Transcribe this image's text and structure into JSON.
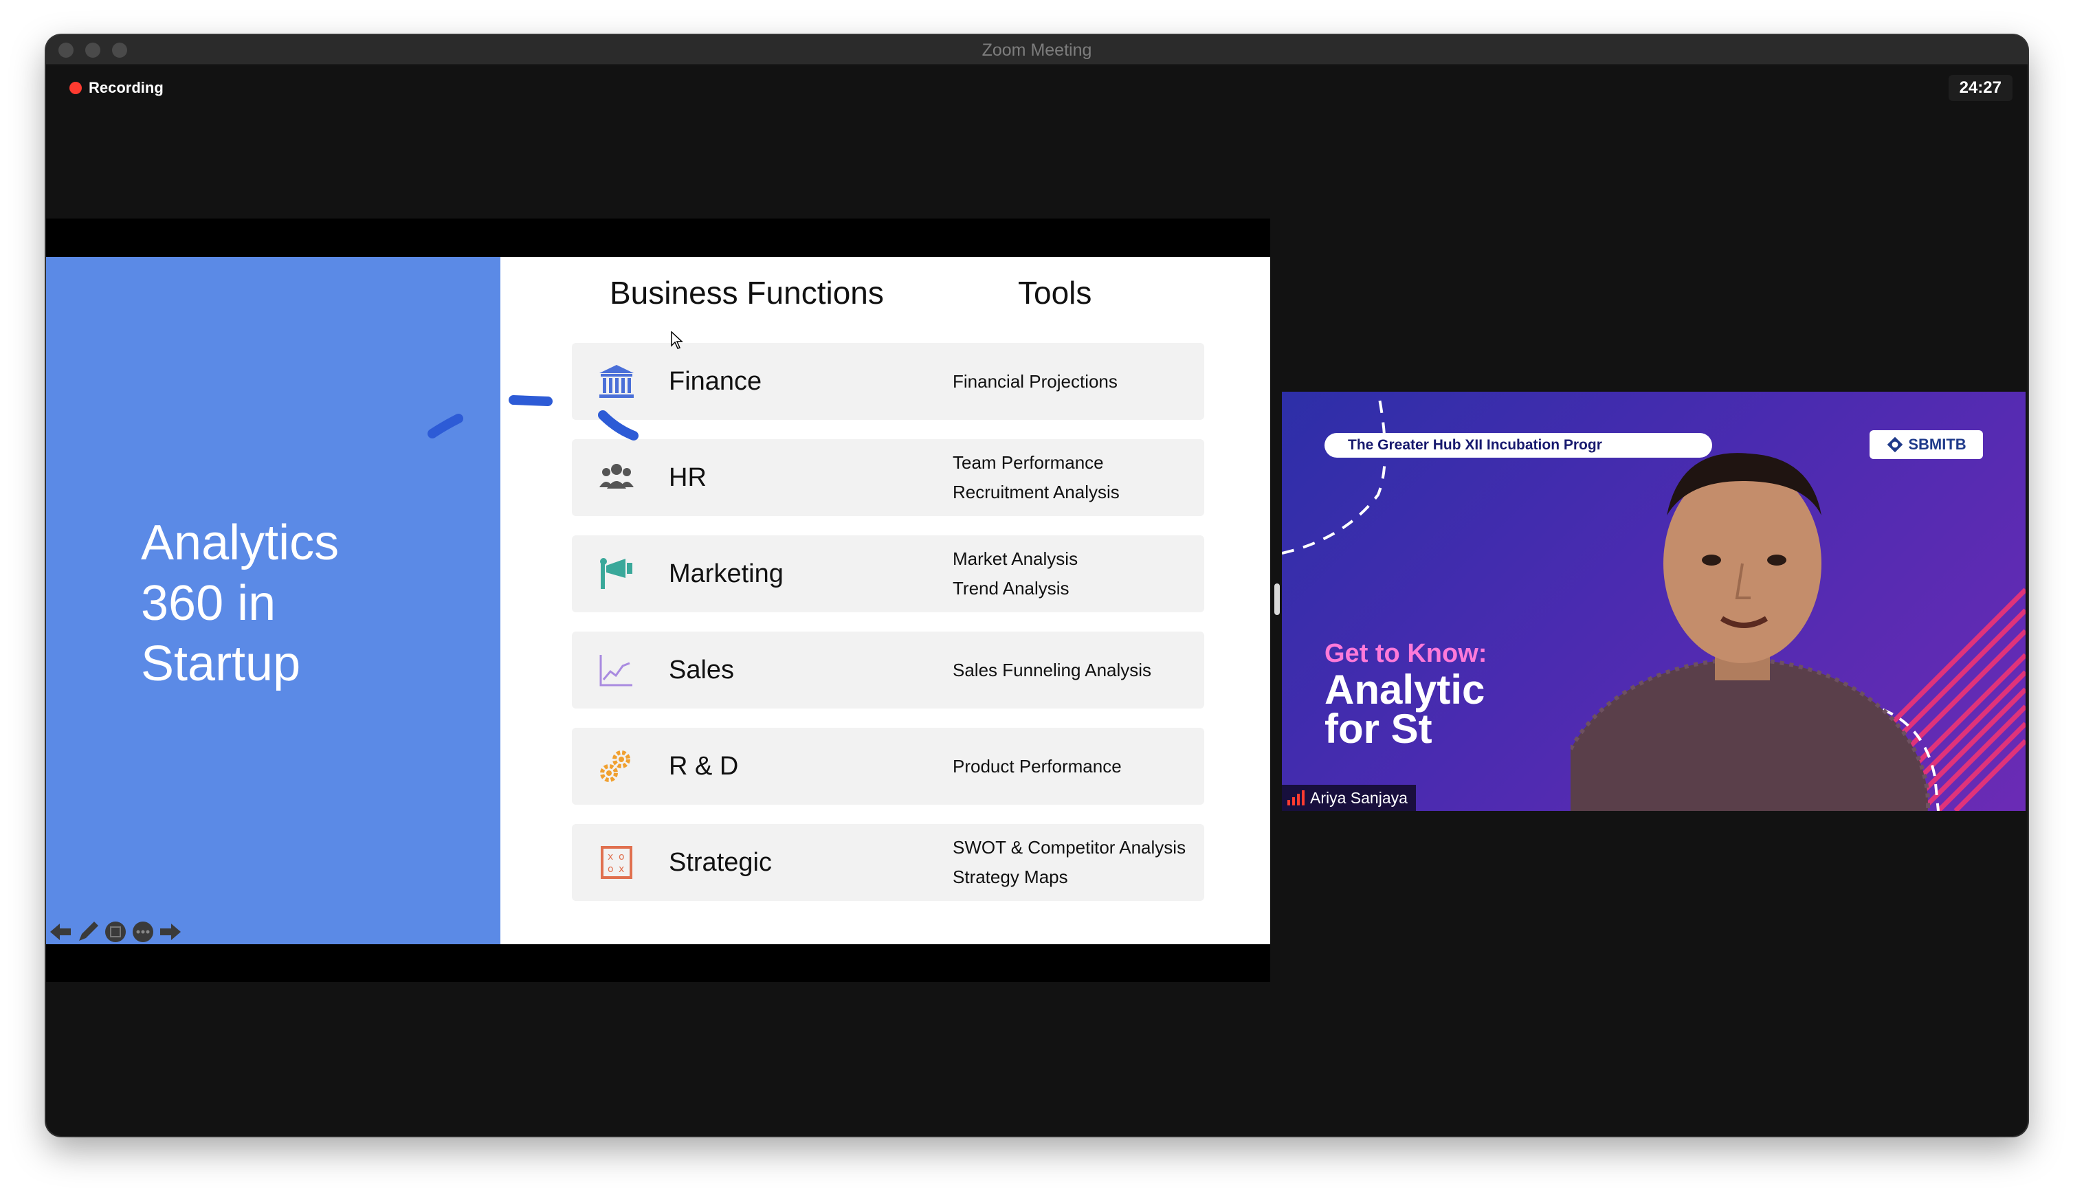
{
  "window": {
    "title": "Zoom Meeting",
    "recording_label": "Recording",
    "timer": "24:27"
  },
  "slide": {
    "title_lines": [
      "Analytics",
      "360 in",
      "Startup"
    ],
    "headers": {
      "functions": "Business Functions",
      "tools": "Tools"
    },
    "rows": [
      {
        "name": "Finance",
        "icon": "bank-icon",
        "tools": [
          "Financial Projections"
        ]
      },
      {
        "name": "HR",
        "icon": "people-icon",
        "tools": [
          "Team Performance",
          "Recruitment Analysis"
        ]
      },
      {
        "name": "Marketing",
        "icon": "megaphone-icon",
        "tools": [
          "Market Analysis",
          "Trend Analysis"
        ]
      },
      {
        "name": "Sales",
        "icon": "line-chart-icon",
        "tools": [
          "Sales Funneling Analysis"
        ]
      },
      {
        "name": "R & D",
        "icon": "gears-icon",
        "tools": [
          "Product Performance"
        ]
      },
      {
        "name": "Strategic",
        "icon": "strategy-board-icon",
        "tools": [
          "SWOT & Competitor Analysis",
          "Strategy Maps"
        ]
      }
    ],
    "colors": {
      "left_panel": "#5b8ae6",
      "row_bg": "#f2f2f2",
      "annotation": "#2d5bd6"
    }
  },
  "video": {
    "banner": "The Greater Hub XII Incubation Progr",
    "logo_text": "SBMITB",
    "get_to_know": "Get to Know:",
    "big_line1": "Analytic",
    "big_line2": "for St",
    "participant_name": "Ariya Sanjaya"
  }
}
